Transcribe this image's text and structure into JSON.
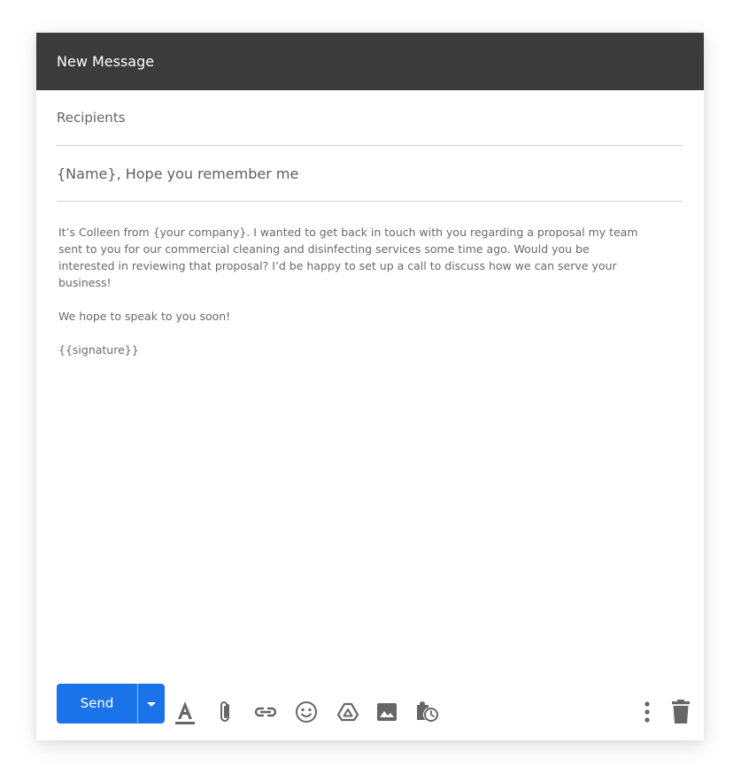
{
  "window": {
    "title": "New Message"
  },
  "recipients": {
    "placeholder": "Recipients"
  },
  "subject": {
    "value": "{Name}, Hope you remember me"
  },
  "body": {
    "paragraphs": [
      "It’s Colleen from {your company}. I wanted to get back in touch with you regarding a proposal my team sent to you for our commercial cleaning and disinfecting services some time ago. Would you be interested in reviewing that proposal? I’d be happy to set up a call to discuss how we can serve your business!",
      "We hope to speak to you soon!",
      "{{signature}}"
    ]
  },
  "toolbar": {
    "send_label": "Send",
    "icons": [
      "caret-down-icon",
      "format-text-icon",
      "attachment-icon",
      "link-icon",
      "emoji-icon",
      "drive-icon",
      "image-icon",
      "schedule-icon",
      "more-options-icon",
      "trash-icon"
    ]
  },
  "colors": {
    "header_bg": "#3b3b3b",
    "send_button": "#1a73e8",
    "icon_gray": "#666666"
  }
}
